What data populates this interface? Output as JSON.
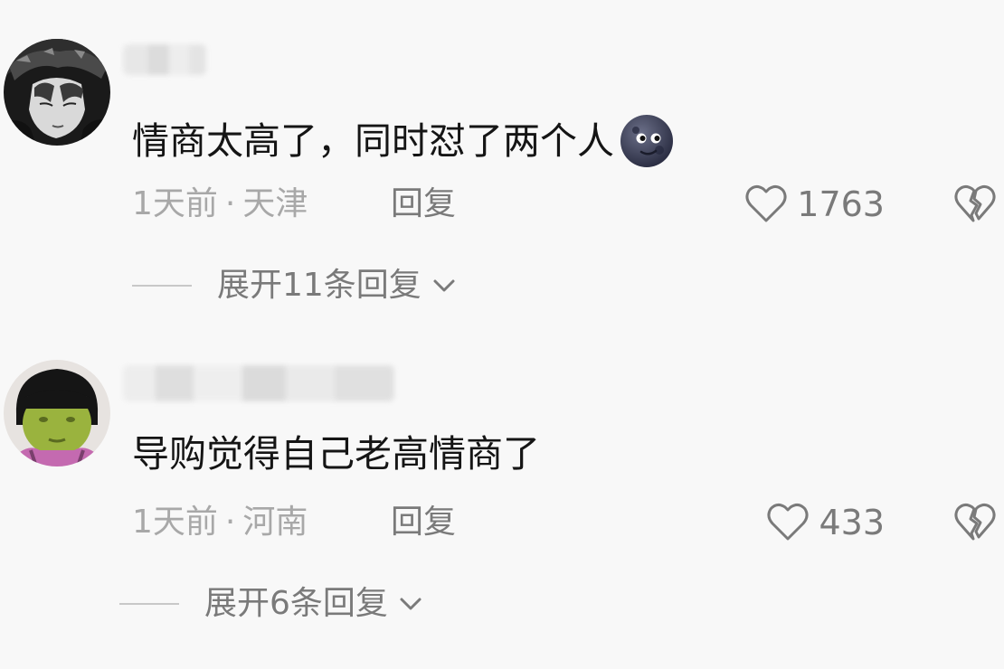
{
  "comments": [
    {
      "text": "情商太高了，同时怼了两个人",
      "emoji_icon": "new-moon-face-icon",
      "time": "1天前",
      "separator": "·",
      "location": "天津",
      "reply_label": "回复",
      "likes": "1763",
      "expand_label": "展开11条回复"
    },
    {
      "text": "导购觉得自己老高情商了",
      "time": "1天前",
      "separator": "·",
      "location": "河南",
      "reply_label": "回复",
      "likes": "433",
      "expand_label": "展开6条回复"
    }
  ],
  "icons": {
    "like": "heart-outline-icon",
    "dislike": "broken-heart-icon",
    "expand": "chevron-down-icon"
  },
  "colors": {
    "background": "#f8f8f8",
    "text": "#151515",
    "meta": "#a8a8a8",
    "action": "#7a7a7a"
  }
}
